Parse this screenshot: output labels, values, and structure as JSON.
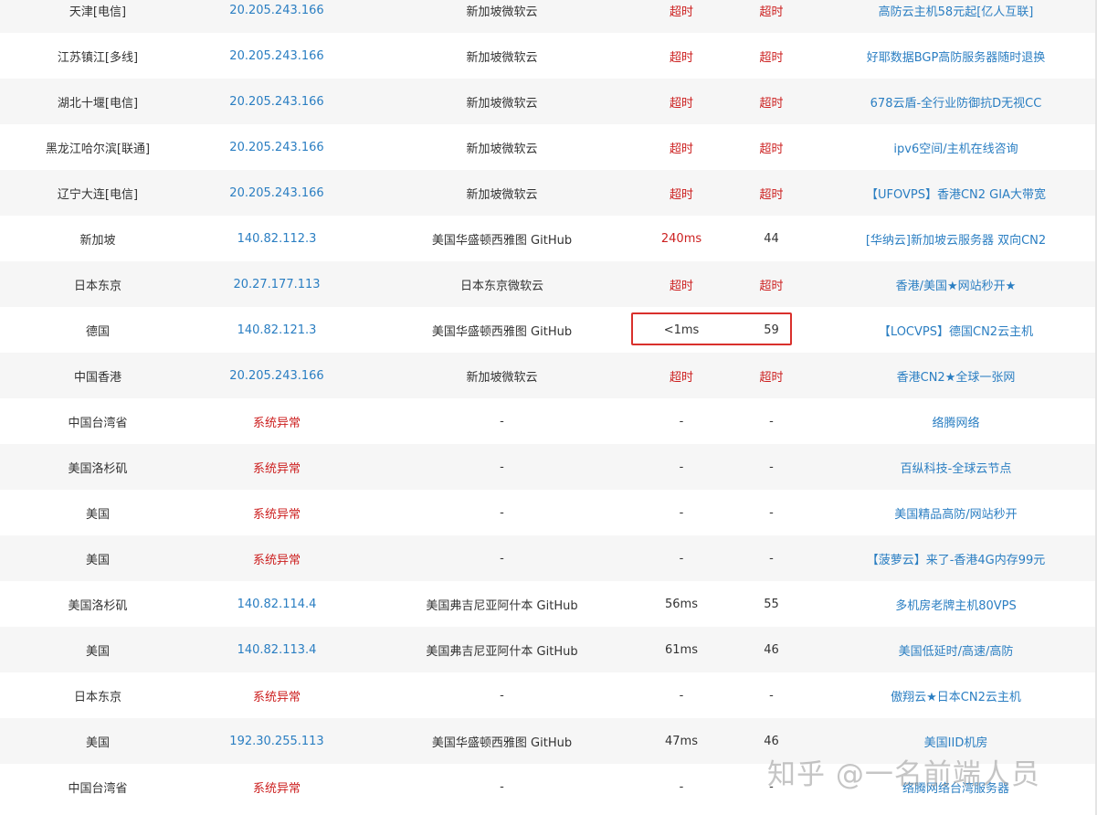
{
  "rows": [
    {
      "location": "天津[电信]",
      "ip": "20.205.243.166",
      "ip_type": "link",
      "isp": "新加坡微软云",
      "time": "超时",
      "time_type": "timeout",
      "ttl": "超时",
      "ttl_type": "timeout",
      "ad": "高防云主机58元起[亿人互联]"
    },
    {
      "location": "江苏镇江[多线]",
      "ip": "20.205.243.166",
      "ip_type": "link",
      "isp": "新加坡微软云",
      "time": "超时",
      "time_type": "timeout",
      "ttl": "超时",
      "ttl_type": "timeout",
      "ad": "好耶数据BGP高防服务器随时退换"
    },
    {
      "location": "湖北十堰[电信]",
      "ip": "20.205.243.166",
      "ip_type": "link",
      "isp": "新加坡微软云",
      "time": "超时",
      "time_type": "timeout",
      "ttl": "超时",
      "ttl_type": "timeout",
      "ad": "678云盾-全行业防御抗D无视CC"
    },
    {
      "location": "黑龙江哈尔滨[联通]",
      "ip": "20.205.243.166",
      "ip_type": "link",
      "isp": "新加坡微软云",
      "time": "超时",
      "time_type": "timeout",
      "ttl": "超时",
      "ttl_type": "timeout",
      "ad": "ipv6空间/主机在线咨询"
    },
    {
      "location": "辽宁大连[电信]",
      "ip": "20.205.243.166",
      "ip_type": "link",
      "isp": "新加坡微软云",
      "time": "超时",
      "time_type": "timeout",
      "ttl": "超时",
      "ttl_type": "timeout",
      "ad": "【UFOVPS】香港CN2 GIA大带宽"
    },
    {
      "location": "新加坡",
      "ip": "140.82.112.3",
      "ip_type": "link",
      "isp": "美国华盛顿西雅图 GitHub",
      "time": "240ms",
      "time_type": "slow",
      "ttl": "44",
      "ttl_type": "normal",
      "ad": "[华纳云]新加坡云服务器 双向CN2"
    },
    {
      "location": "日本东京",
      "ip": "20.27.177.113",
      "ip_type": "link",
      "isp": "日本东京微软云",
      "time": "超时",
      "time_type": "timeout",
      "ttl": "超时",
      "ttl_type": "timeout",
      "ad": "香港/美国★网站秒开★"
    },
    {
      "location": "德国",
      "ip": "140.82.121.3",
      "ip_type": "link",
      "isp": "美国华盛顿西雅图 GitHub",
      "time": "<1ms",
      "time_type": "normal",
      "ttl": "59",
      "ttl_type": "normal",
      "ad": "【LOCVPS】德国CN2云主机"
    },
    {
      "location": "中国香港",
      "ip": "20.205.243.166",
      "ip_type": "link",
      "isp": "新加坡微软云",
      "time": "超时",
      "time_type": "timeout",
      "ttl": "超时",
      "ttl_type": "timeout",
      "ad": "香港CN2★全球一张网"
    },
    {
      "location": "中国台湾省",
      "ip": "系统异常",
      "ip_type": "error",
      "isp": "-",
      "time": "-",
      "time_type": "normal",
      "ttl": "-",
      "ttl_type": "normal",
      "ad": "络腾网络"
    },
    {
      "location": "美国洛杉矶",
      "ip": "系统异常",
      "ip_type": "error",
      "isp": "-",
      "time": "-",
      "time_type": "normal",
      "ttl": "-",
      "ttl_type": "normal",
      "ad": "百纵科技-全球云节点"
    },
    {
      "location": "美国",
      "ip": "系统异常",
      "ip_type": "error",
      "isp": "-",
      "time": "-",
      "time_type": "normal",
      "ttl": "-",
      "ttl_type": "normal",
      "ad": "美国精品高防/网站秒开"
    },
    {
      "location": "美国",
      "ip": "系统异常",
      "ip_type": "error",
      "isp": "-",
      "time": "-",
      "time_type": "normal",
      "ttl": "-",
      "ttl_type": "normal",
      "ad": "【菠萝云】来了-香港4G内存99元"
    },
    {
      "location": "美国洛杉矶",
      "ip": "140.82.114.4",
      "ip_type": "link",
      "isp": "美国弗吉尼亚阿什本 GitHub",
      "time": "56ms",
      "time_type": "normal",
      "ttl": "55",
      "ttl_type": "normal",
      "ad": "多机房老牌主机80VPS"
    },
    {
      "location": "美国",
      "ip": "140.82.113.4",
      "ip_type": "link",
      "isp": "美国弗吉尼亚阿什本 GitHub",
      "time": "61ms",
      "time_type": "normal",
      "ttl": "46",
      "ttl_type": "normal",
      "ad": "美国低延时/高速/高防"
    },
    {
      "location": "日本东京",
      "ip": "系统异常",
      "ip_type": "error",
      "isp": "-",
      "time": "-",
      "time_type": "normal",
      "ttl": "-",
      "ttl_type": "normal",
      "ad": "傲翔云★日本CN2云主机"
    },
    {
      "location": "美国",
      "ip": "192.30.255.113",
      "ip_type": "link",
      "isp": "美国华盛顿西雅图 GitHub",
      "time": "47ms",
      "time_type": "normal",
      "ttl": "46",
      "ttl_type": "normal",
      "ad": "美国IID机房"
    },
    {
      "location": "中国台湾省",
      "ip": "系统异常",
      "ip_type": "error",
      "isp": "-",
      "time": "-",
      "time_type": "normal",
      "ttl": "-",
      "ttl_type": "normal",
      "ad": "络腾网络台湾服务器"
    }
  ],
  "watermark": "知乎 @一名前端人员",
  "colors": {
    "link": "#2a7ec2",
    "error": "#cc1f1f",
    "highlight": "#d9302c"
  }
}
